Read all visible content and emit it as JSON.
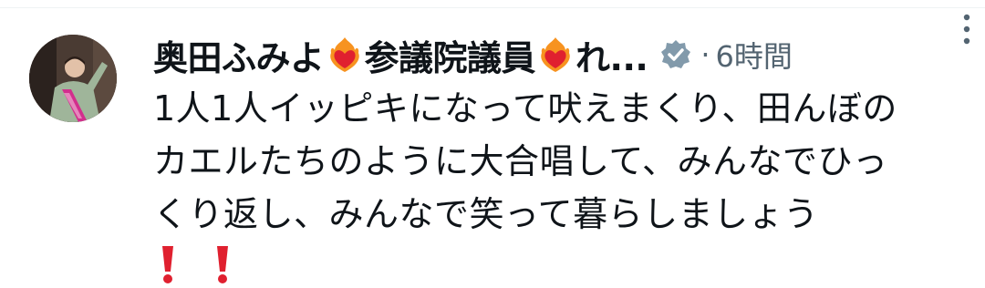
{
  "tweet": {
    "display_name_part1": "奥田ふみよ",
    "display_name_part2": "参議院議員",
    "display_name_part3": "れ...",
    "separator": "·",
    "timestamp": "6時間",
    "text_lines": [
      "1人1人イッピキになって吠えまくり、田んぼの",
      "カエルたちのように大合唱して、みんなでひっ",
      "くり返し、みんなで笑って暮らしましょう"
    ]
  },
  "icons": {
    "heart": "sparkling-heart-fire-icon",
    "verified": "verified-badge-icon",
    "more": "more-vertical-icon",
    "exclaim": "red-exclamation-icon"
  },
  "colors": {
    "text": "#0f1419",
    "muted": "#536471",
    "verified_badge": "#829aab",
    "heart_red": "#e0202f",
    "heart_orange": "#f79320",
    "exclaim_red": "#e0202f"
  }
}
